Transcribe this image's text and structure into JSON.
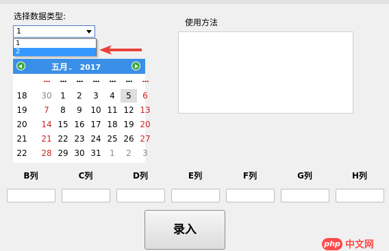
{
  "form": {
    "data_type_label": "选择数据类型:",
    "usage_label": "使用方法",
    "submit_label": "录入"
  },
  "combo": {
    "value": "1",
    "options": [
      "1",
      "2"
    ]
  },
  "calendar": {
    "month": "五月",
    "year": "2017",
    "header_dots": [
      "...",
      "...",
      "...",
      "...",
      "...",
      "...",
      "..."
    ],
    "weeks": [
      [
        "18",
        "30",
        "1",
        "2",
        "3",
        "4",
        "5",
        "6"
      ],
      [
        "19",
        "7",
        "8",
        "9",
        "10",
        "11",
        "12",
        "13"
      ],
      [
        "20",
        "14",
        "15",
        "16",
        "17",
        "18",
        "19",
        "20"
      ],
      [
        "21",
        "21",
        "22",
        "23",
        "24",
        "25",
        "26",
        "27"
      ],
      [
        "22",
        "28",
        "29",
        "30",
        "31",
        "1",
        "2",
        "3"
      ]
    ],
    "today": "5",
    "colors": {
      "weekend": "#cc2222",
      "other_month": "#888888",
      "header": "#3a90e6"
    }
  },
  "columns": [
    "B列",
    "C列",
    "D列",
    "E列",
    "F列",
    "G列",
    "H列"
  ],
  "watermark": {
    "badge": "php",
    "text": "中文网"
  }
}
